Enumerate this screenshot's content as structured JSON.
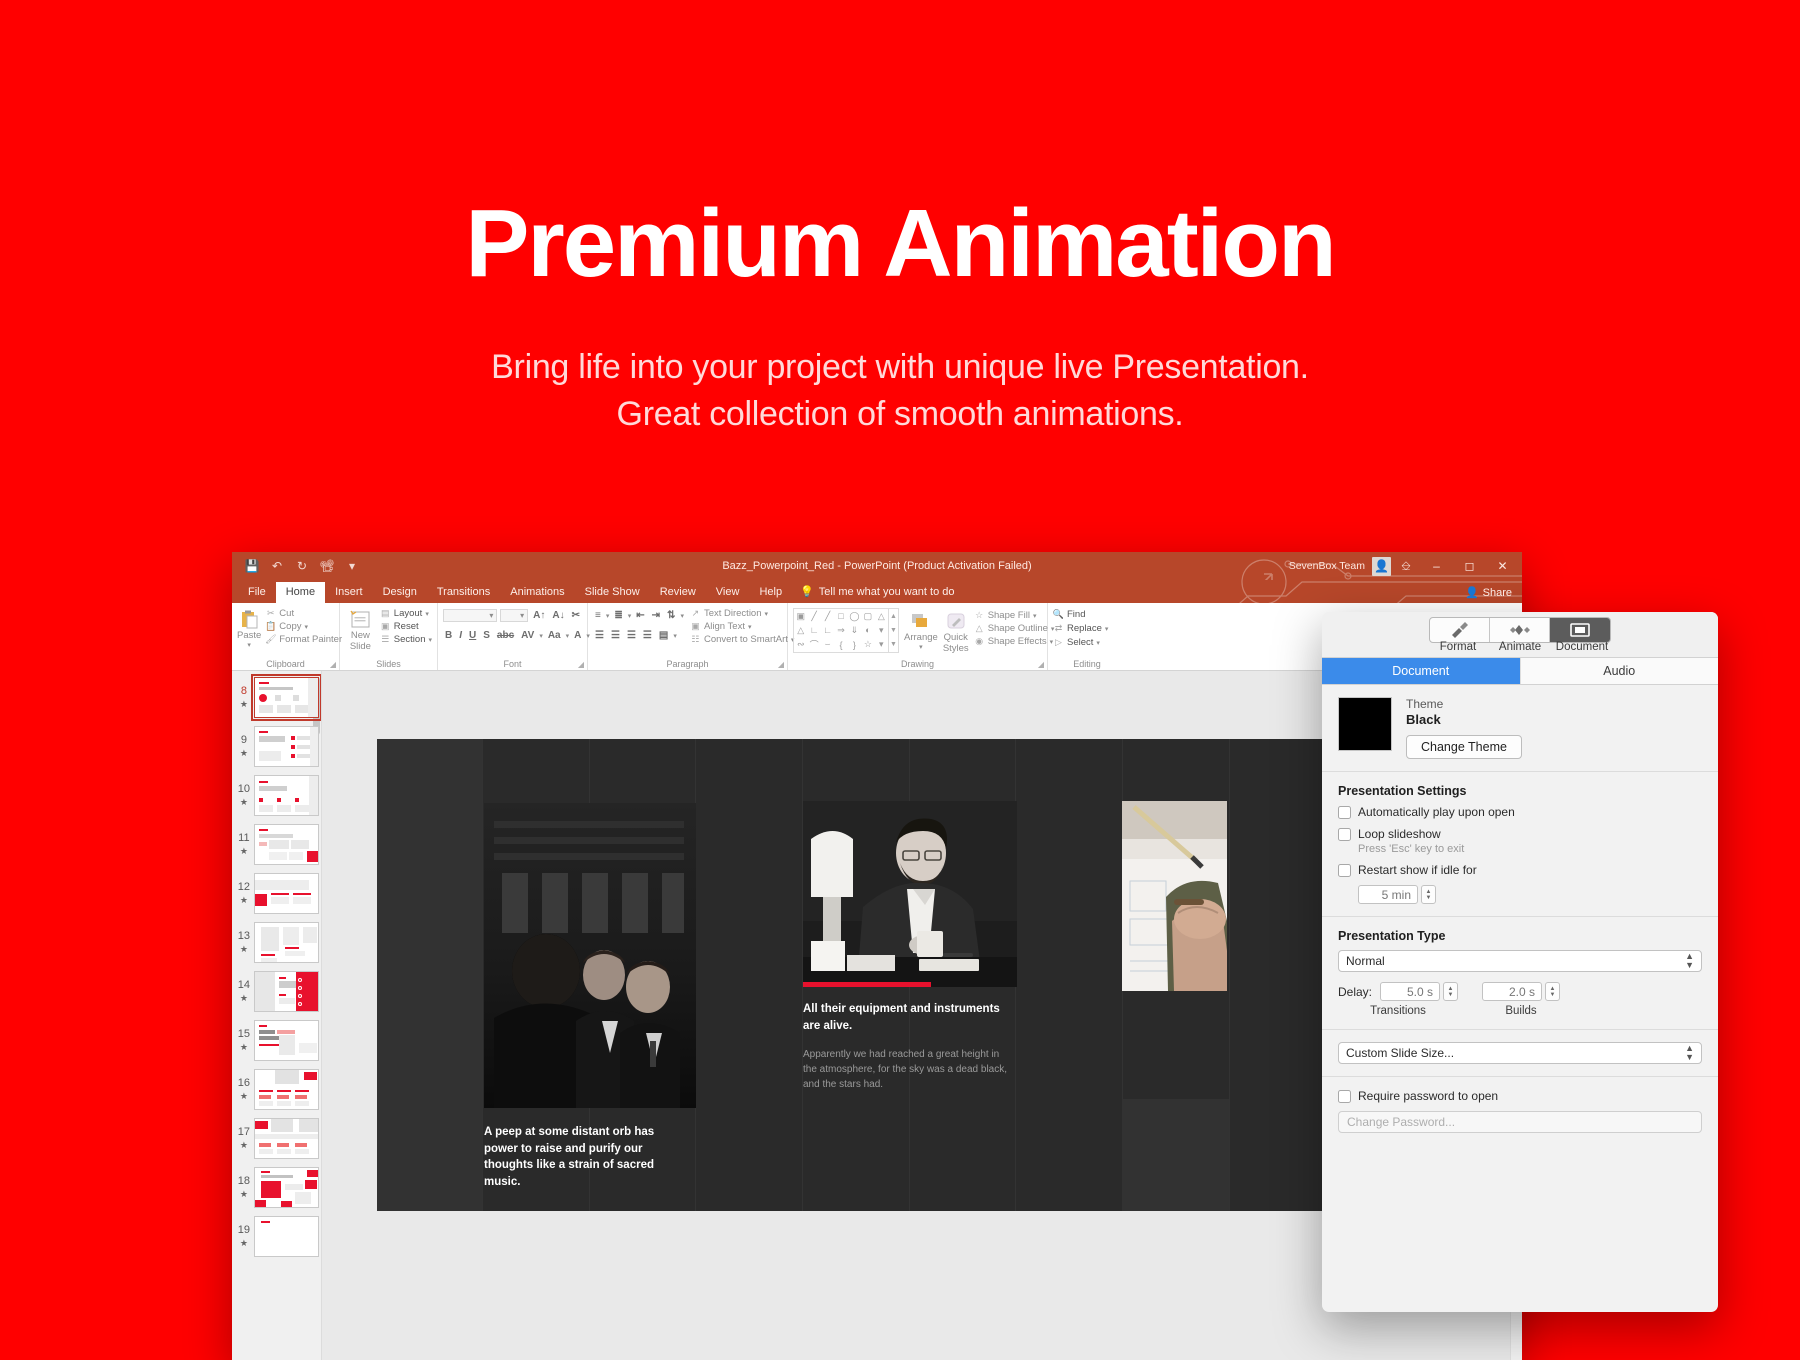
{
  "hero": {
    "title": "Premium Animation",
    "subtitle_line1": "Bring life into your project with unique live Presentation.",
    "subtitle_line2": "Great collection of smooth animations.",
    "bg_color": "#FF0000",
    "title_color": "#FFFFFF",
    "subtitle_color": "#FFD9D9"
  },
  "powerpoint": {
    "titlebar": {
      "document_title": "Bazz_Powerpoint_Red  -  PowerPoint (Product Activation Failed)",
      "account_name": "SevenBox Team",
      "quick_access": [
        "save-icon",
        "undo-icon",
        "redo-icon",
        "start-slideshow-icon",
        "customize-qat-icon"
      ],
      "window_controls": [
        "minimize",
        "maximize",
        "close"
      ],
      "accent_color": "#B7472A"
    },
    "tabs": [
      {
        "label": "File",
        "active": false
      },
      {
        "label": "Home",
        "active": true
      },
      {
        "label": "Insert",
        "active": false
      },
      {
        "label": "Design",
        "active": false
      },
      {
        "label": "Transitions",
        "active": false
      },
      {
        "label": "Animations",
        "active": false
      },
      {
        "label": "Slide Show",
        "active": false
      },
      {
        "label": "Review",
        "active": false
      },
      {
        "label": "View",
        "active": false
      },
      {
        "label": "Help",
        "active": false
      }
    ],
    "tell_me": "Tell me what you want to do",
    "share_label": "Share",
    "ribbon": {
      "clipboard": {
        "group_label": "Clipboard",
        "paste_label": "Paste",
        "items": [
          "Cut",
          "Copy",
          "Format Painter"
        ]
      },
      "slides": {
        "group_label": "Slides",
        "new_slide_line1": "New",
        "new_slide_line2": "Slide",
        "items": [
          "Layout",
          "Reset",
          "Section"
        ]
      },
      "font": {
        "group_label": "Font",
        "font_name": "",
        "font_size": "",
        "tools": [
          "B",
          "I",
          "U",
          "S",
          "abc",
          "AV",
          "Aa",
          "A"
        ]
      },
      "paragraph": {
        "group_label": "Paragraph",
        "items": [
          "Text Direction",
          "Align Text",
          "Convert to SmartArt"
        ]
      },
      "drawing": {
        "group_label": "Drawing",
        "arrange_label": "Arrange",
        "quick_styles_line1": "Quick",
        "quick_styles_line2": "Styles",
        "items": [
          "Shape Fill",
          "Shape Outline",
          "Shape Effects"
        ]
      },
      "editing": {
        "group_label": "Editing",
        "items": [
          "Find",
          "Replace",
          "Select"
        ]
      }
    },
    "thumbnails": [
      {
        "number": "8",
        "selected": true
      },
      {
        "number": "9",
        "selected": false
      },
      {
        "number": "10",
        "selected": false
      },
      {
        "number": "11",
        "selected": false
      },
      {
        "number": "12",
        "selected": false
      },
      {
        "number": "13",
        "selected": false
      },
      {
        "number": "14",
        "selected": false
      },
      {
        "number": "15",
        "selected": false
      },
      {
        "number": "16",
        "selected": false
      },
      {
        "number": "17",
        "selected": false
      },
      {
        "number": "18",
        "selected": false
      },
      {
        "number": "19",
        "selected": false
      }
    ],
    "slide": {
      "background_color": "#2A2A2A",
      "left_caption": "A peep at some distant orb has power to raise and purify our thoughts like a strain of sacred music.",
      "center_heading": "All their equipment and instruments are alive.",
      "center_body": "Apparently we had reached a great height in the atmosphere, for the sky was a dead black, and the stars had.",
      "accent_color": "#E8112D",
      "photos": [
        "businessmen-conversation-photo",
        "man-working-desk-photo",
        "hand-drawing-blueprint-photo"
      ]
    }
  },
  "inspector": {
    "segments": [
      {
        "label": "Format",
        "icon": "paintbrush-icon",
        "active": false
      },
      {
        "label": "Animate",
        "icon": "diamond-icon",
        "active": false
      },
      {
        "label": "Document",
        "icon": "document-icon",
        "active": true
      }
    ],
    "tabs": [
      {
        "label": "Document",
        "active": true
      },
      {
        "label": "Audio",
        "active": false
      }
    ],
    "theme": {
      "label": "Theme",
      "name": "Black",
      "change_button": "Change Theme"
    },
    "presentation": {
      "heading": "Presentation Settings",
      "autoplay_label": "Automatically play upon open",
      "autoplay_checked": false,
      "loop_label": "Loop slideshow",
      "loop_sub": "Press 'Esc' key to exit",
      "loop_checked": false,
      "restart_label": "Restart show if idle for",
      "restart_checked": false,
      "restart_value": "5 min"
    },
    "transition": {
      "heading": "Presentation Type",
      "type_value": "Normal",
      "delay_label": "Delay:",
      "transitions_value": "5.0 s",
      "transitions_caption": "Transitions",
      "builds_value": "2.0 s",
      "builds_caption": "Builds"
    },
    "slide_size": {
      "value": "Custom Slide Size..."
    },
    "password": {
      "require_label": "Require password to open",
      "require_checked": false,
      "change_placeholder": "Change Password..."
    }
  }
}
